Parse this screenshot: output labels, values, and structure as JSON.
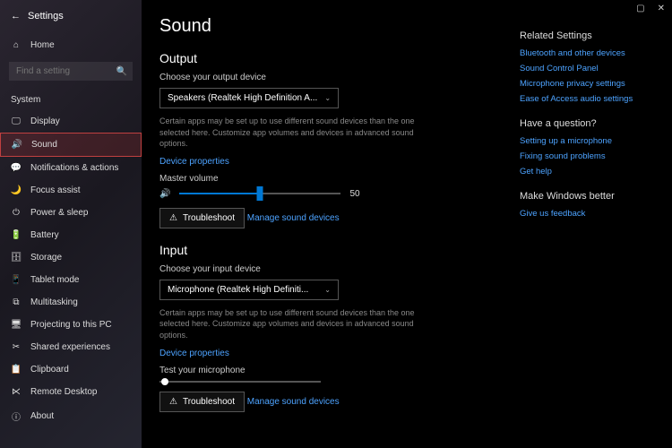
{
  "window": {
    "title": "Settings"
  },
  "sidebar": {
    "home": "Home",
    "search_placeholder": "Find a setting",
    "group": "System",
    "items": [
      {
        "icon": "🖵",
        "label": "Display"
      },
      {
        "icon": "🔊",
        "label": "Sound"
      },
      {
        "icon": "💬",
        "label": "Notifications & actions"
      },
      {
        "icon": "🌙",
        "label": "Focus assist"
      },
      {
        "icon": "⏻",
        "label": "Power & sleep"
      },
      {
        "icon": "🔋",
        "label": "Battery"
      },
      {
        "icon": "🗄",
        "label": "Storage"
      },
      {
        "icon": "📱",
        "label": "Tablet mode"
      },
      {
        "icon": "⧉",
        "label": "Multitasking"
      },
      {
        "icon": "🖥",
        "label": "Projecting to this PC"
      },
      {
        "icon": "✂",
        "label": "Shared experiences"
      },
      {
        "icon": "📋",
        "label": "Clipboard"
      },
      {
        "icon": "⋉",
        "label": "Remote Desktop"
      },
      {
        "icon": "ⓘ",
        "label": "About"
      }
    ]
  },
  "page": {
    "title": "Sound",
    "output": {
      "heading": "Output",
      "choose_label": "Choose your output device",
      "device": "Speakers (Realtek High Definition A...",
      "desc": "Certain apps may be set up to use different sound devices than the one selected here. Customize app volumes and devices in advanced sound options.",
      "device_props": "Device properties",
      "master_label": "Master volume",
      "volume": 50,
      "volume_text": "50",
      "troubleshoot": "Troubleshoot",
      "manage": "Manage sound devices"
    },
    "input": {
      "heading": "Input",
      "choose_label": "Choose your input device",
      "device": "Microphone (Realtek High Definiti...",
      "desc": "Certain apps may be set up to use different sound devices than the one selected here. Customize app volumes and devices in advanced sound options.",
      "device_props": "Device properties",
      "test_label": "Test your microphone",
      "troubleshoot": "Troubleshoot",
      "manage": "Manage sound devices"
    }
  },
  "right": {
    "related_heading": "Related Settings",
    "related": [
      "Bluetooth and other devices",
      "Sound Control Panel",
      "Microphone privacy settings",
      "Ease of Access audio settings"
    ],
    "question_heading": "Have a question?",
    "question": [
      "Setting up a microphone",
      "Fixing sound problems",
      "Get help"
    ],
    "better_heading": "Make Windows better",
    "better": [
      "Give us feedback"
    ]
  }
}
